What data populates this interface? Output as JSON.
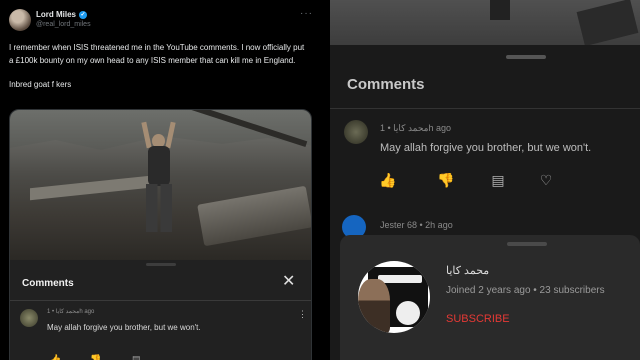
{
  "tweet": {
    "author_name": "Lord Miles",
    "author_handle": "@real_lord_miles",
    "verified_mark": "✓",
    "more_icon": "···",
    "paragraph1": "I remember when ISIS threatened me in the YouTube comments. I now officially put a £100k bounty on my own head to any ISIS member that can kill me in England.",
    "paragraph2": "Inbred goat f    kers"
  },
  "embedded_sheet": {
    "title": "Comments",
    "close_icon": "✕",
    "comment": {
      "meta": "محمد كايا • 1h ago",
      "text": "May allah forgive you brother,  but we won't.",
      "more_icon": "⋮"
    }
  },
  "right_panel": {
    "title": "Comments",
    "comment": {
      "meta": "محمد كايا • 1h ago",
      "text": "May allah forgive you brother,  but we won't."
    },
    "actions": {
      "like_icon": "👍",
      "dislike_icon": "👎",
      "reply_icon": "▤",
      "heart_icon": "♡"
    },
    "comment2_meta": "Jester 68 • 2h ago",
    "channel": {
      "name": "محمد كايا",
      "meta": "Joined 2 years ago • 23 subscribers",
      "subscribe_label": "SUBSCRIBE"
    }
  },
  "colors": {
    "accent_red": "#e53935",
    "verified_blue": "#1d9bf0"
  }
}
